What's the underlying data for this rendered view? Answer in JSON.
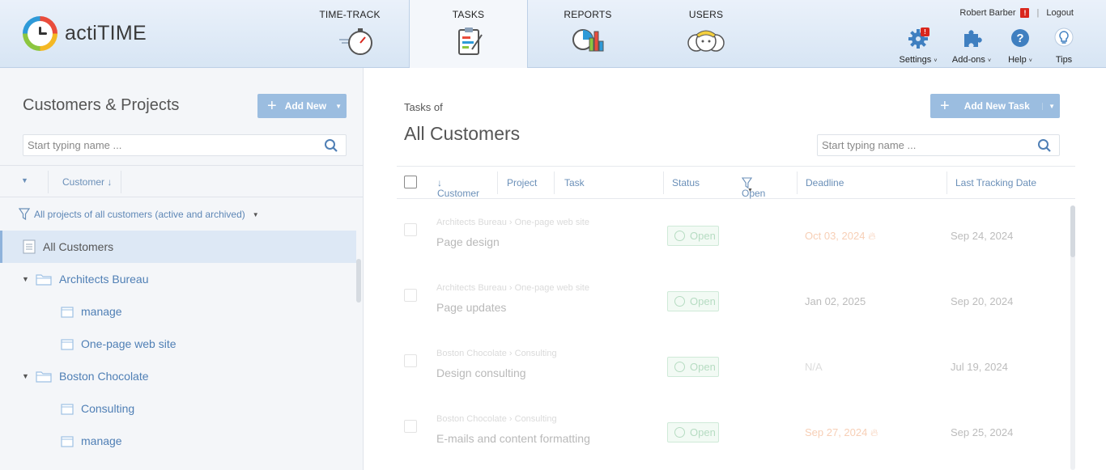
{
  "app": {
    "logo_text": "actiTIME"
  },
  "nav": {
    "tabs": [
      {
        "label": "TIME-TRACK",
        "icon": "stopwatch-icon"
      },
      {
        "label": "TASKS",
        "icon": "clipboard-icon"
      },
      {
        "label": "REPORTS",
        "icon": "pie-bar-chart-icon"
      },
      {
        "label": "USERS",
        "icon": "users-icon"
      }
    ]
  },
  "user": {
    "name": "Robert Barber",
    "warning": "!",
    "logout": "Logout"
  },
  "tools": [
    {
      "label": "Settings",
      "icon": "gear-icon",
      "badge": "!"
    },
    {
      "label": "Add-ons",
      "icon": "puzzle-icon"
    },
    {
      "label": "Help",
      "icon": "help-icon"
    },
    {
      "label": "Tips",
      "icon": "lightbulb-icon"
    }
  ],
  "left": {
    "title": "Customers & Projects",
    "add_new": "Add New",
    "search_placeholder": "Start typing name ...",
    "sort_label": "Customer",
    "filter_label": "All projects of all customers (active and archived)",
    "tree": [
      {
        "label": "All Customers",
        "type": "all",
        "selected": true
      },
      {
        "label": "Architects Bureau",
        "type": "customer"
      },
      {
        "label": "manage",
        "type": "project"
      },
      {
        "label": "One-page web site",
        "type": "project"
      },
      {
        "label": "Boston Chocolate",
        "type": "customer"
      },
      {
        "label": "Consulting",
        "type": "project"
      },
      {
        "label": "manage",
        "type": "project"
      }
    ]
  },
  "right": {
    "tasks_of": "Tasks of",
    "title": "All Customers",
    "add_task": "Add New Task",
    "search_placeholder": "Start typing name ...",
    "columns": {
      "customer": "Customer",
      "project": "Project",
      "task": "Task",
      "status": "Status",
      "status_filter": "Open",
      "deadline": "Deadline",
      "last_tracking": "Last Tracking Date"
    },
    "rows": [
      {
        "customer": "Architects Bureau",
        "project": "One-page web site",
        "task": "Page design",
        "status": "Open",
        "deadline": "Oct 03, 2024",
        "deadline_state": "warn",
        "last_tracking": "Sep 24, 2024"
      },
      {
        "customer": "Architects Bureau",
        "project": "One-page web site",
        "task": "Page updates",
        "status": "Open",
        "deadline": "Jan 02, 2025",
        "deadline_state": "normal",
        "last_tracking": "Sep 20, 2024"
      },
      {
        "customer": "Boston Chocolate",
        "project": "Consulting",
        "task": "Design consulting",
        "status": "Open",
        "deadline": "N/A",
        "deadline_state": "na",
        "last_tracking": "Jul 19, 2024"
      },
      {
        "customer": "Boston Chocolate",
        "project": "Consulting",
        "task": "E-mails and content formatting",
        "status": "Open",
        "deadline": "Sep 27, 2024",
        "deadline_state": "warn",
        "last_tracking": "Sep 25, 2024"
      }
    ]
  },
  "colors": {
    "accent": "#9bbde0",
    "link": "#4f7fb5",
    "warning": "#d9261c",
    "status_open": "#b6dcc2"
  }
}
